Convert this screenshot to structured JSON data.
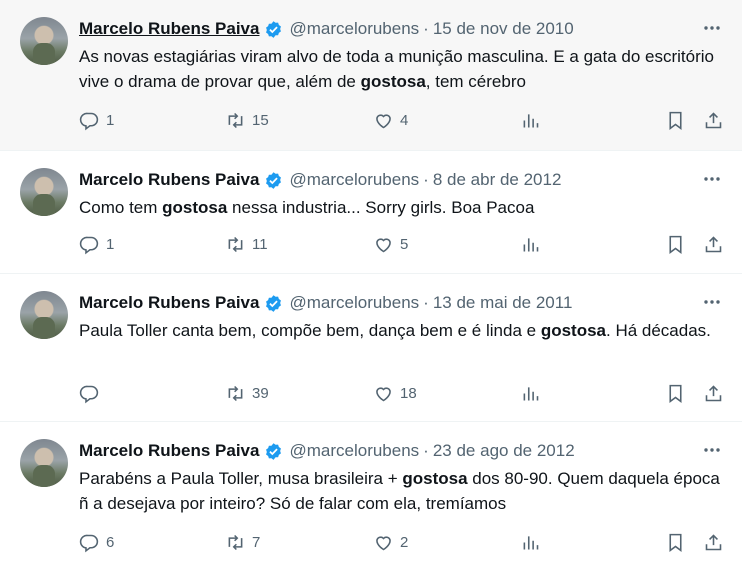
{
  "tweets": [
    {
      "name": "Marcelo Rubens Paiva",
      "handle": "@marcelorubens",
      "date": "15 de nov de 2010",
      "text_parts": [
        "As novas estagiárias viram alvo de toda a munição masculina. E a gata do escritório vive o drama de provar que, além de ",
        "gostosa",
        ", tem cérebro"
      ],
      "replies": "1",
      "retweets": "15",
      "likes": "4"
    },
    {
      "name": "Marcelo Rubens Paiva",
      "handle": "@marcelorubens",
      "date": "8 de abr de 2012",
      "text_parts": [
        "Como tem ",
        "gostosa",
        " nessa industria... Sorry girls. Boa Pacoa"
      ],
      "replies": "1",
      "retweets": "11",
      "likes": "5"
    },
    {
      "name": "Marcelo Rubens Paiva",
      "handle": "@marcelorubens",
      "date": "13 de mai de 2011",
      "text_parts": [
        "Paula Toller canta bem, compõe bem, dança bem e é linda e ",
        "gostosa",
        ". Há décadas."
      ],
      "replies": "",
      "retweets": "39",
      "likes": "18"
    },
    {
      "name": "Marcelo Rubens Paiva",
      "handle": "@marcelorubens",
      "date": "23 de ago de 2012",
      "text_parts": [
        "Parabéns a Paula Toller, musa brasileira + ",
        "gostosa",
        " dos 80-90. Quem daquela época ñ a desejava por inteiro? Só de falar com ela, tremíamos"
      ],
      "replies": "6",
      "retweets": "7",
      "likes": "2"
    }
  ],
  "icons": {
    "verified": "verified-badge-icon",
    "more": "more-icon",
    "reply": "reply-icon",
    "retweet": "retweet-icon",
    "like": "heart-icon",
    "views": "views-icon",
    "bookmark": "bookmark-icon",
    "share": "share-icon"
  },
  "colors": {
    "verified": "#1d9bf0",
    "secondary": "#536471",
    "text": "#0f1419",
    "hover_bg": "#f7f7f7"
  }
}
